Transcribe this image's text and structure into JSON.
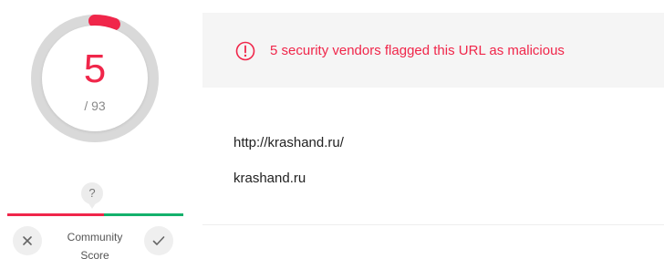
{
  "score": {
    "value": "5",
    "total": "/ 93",
    "detected_fraction": 0.054,
    "accent_color": "#f0264a",
    "track_color": "#d9d9d9"
  },
  "community": {
    "question_mark": "?",
    "label_line1": "Community",
    "label_line2": "Score",
    "negative_fraction": 0.55,
    "negative_color": "#f0264a",
    "positive_color": "#14b16c",
    "downvote_icon": "close-icon",
    "upvote_icon": "check-icon"
  },
  "detection": {
    "alert_icon": "exclamation-circle-icon",
    "alert_text": "5 security vendors flagged this URL as malicious",
    "url": "http://krashand.ru/",
    "domain": "krashand.ru"
  }
}
